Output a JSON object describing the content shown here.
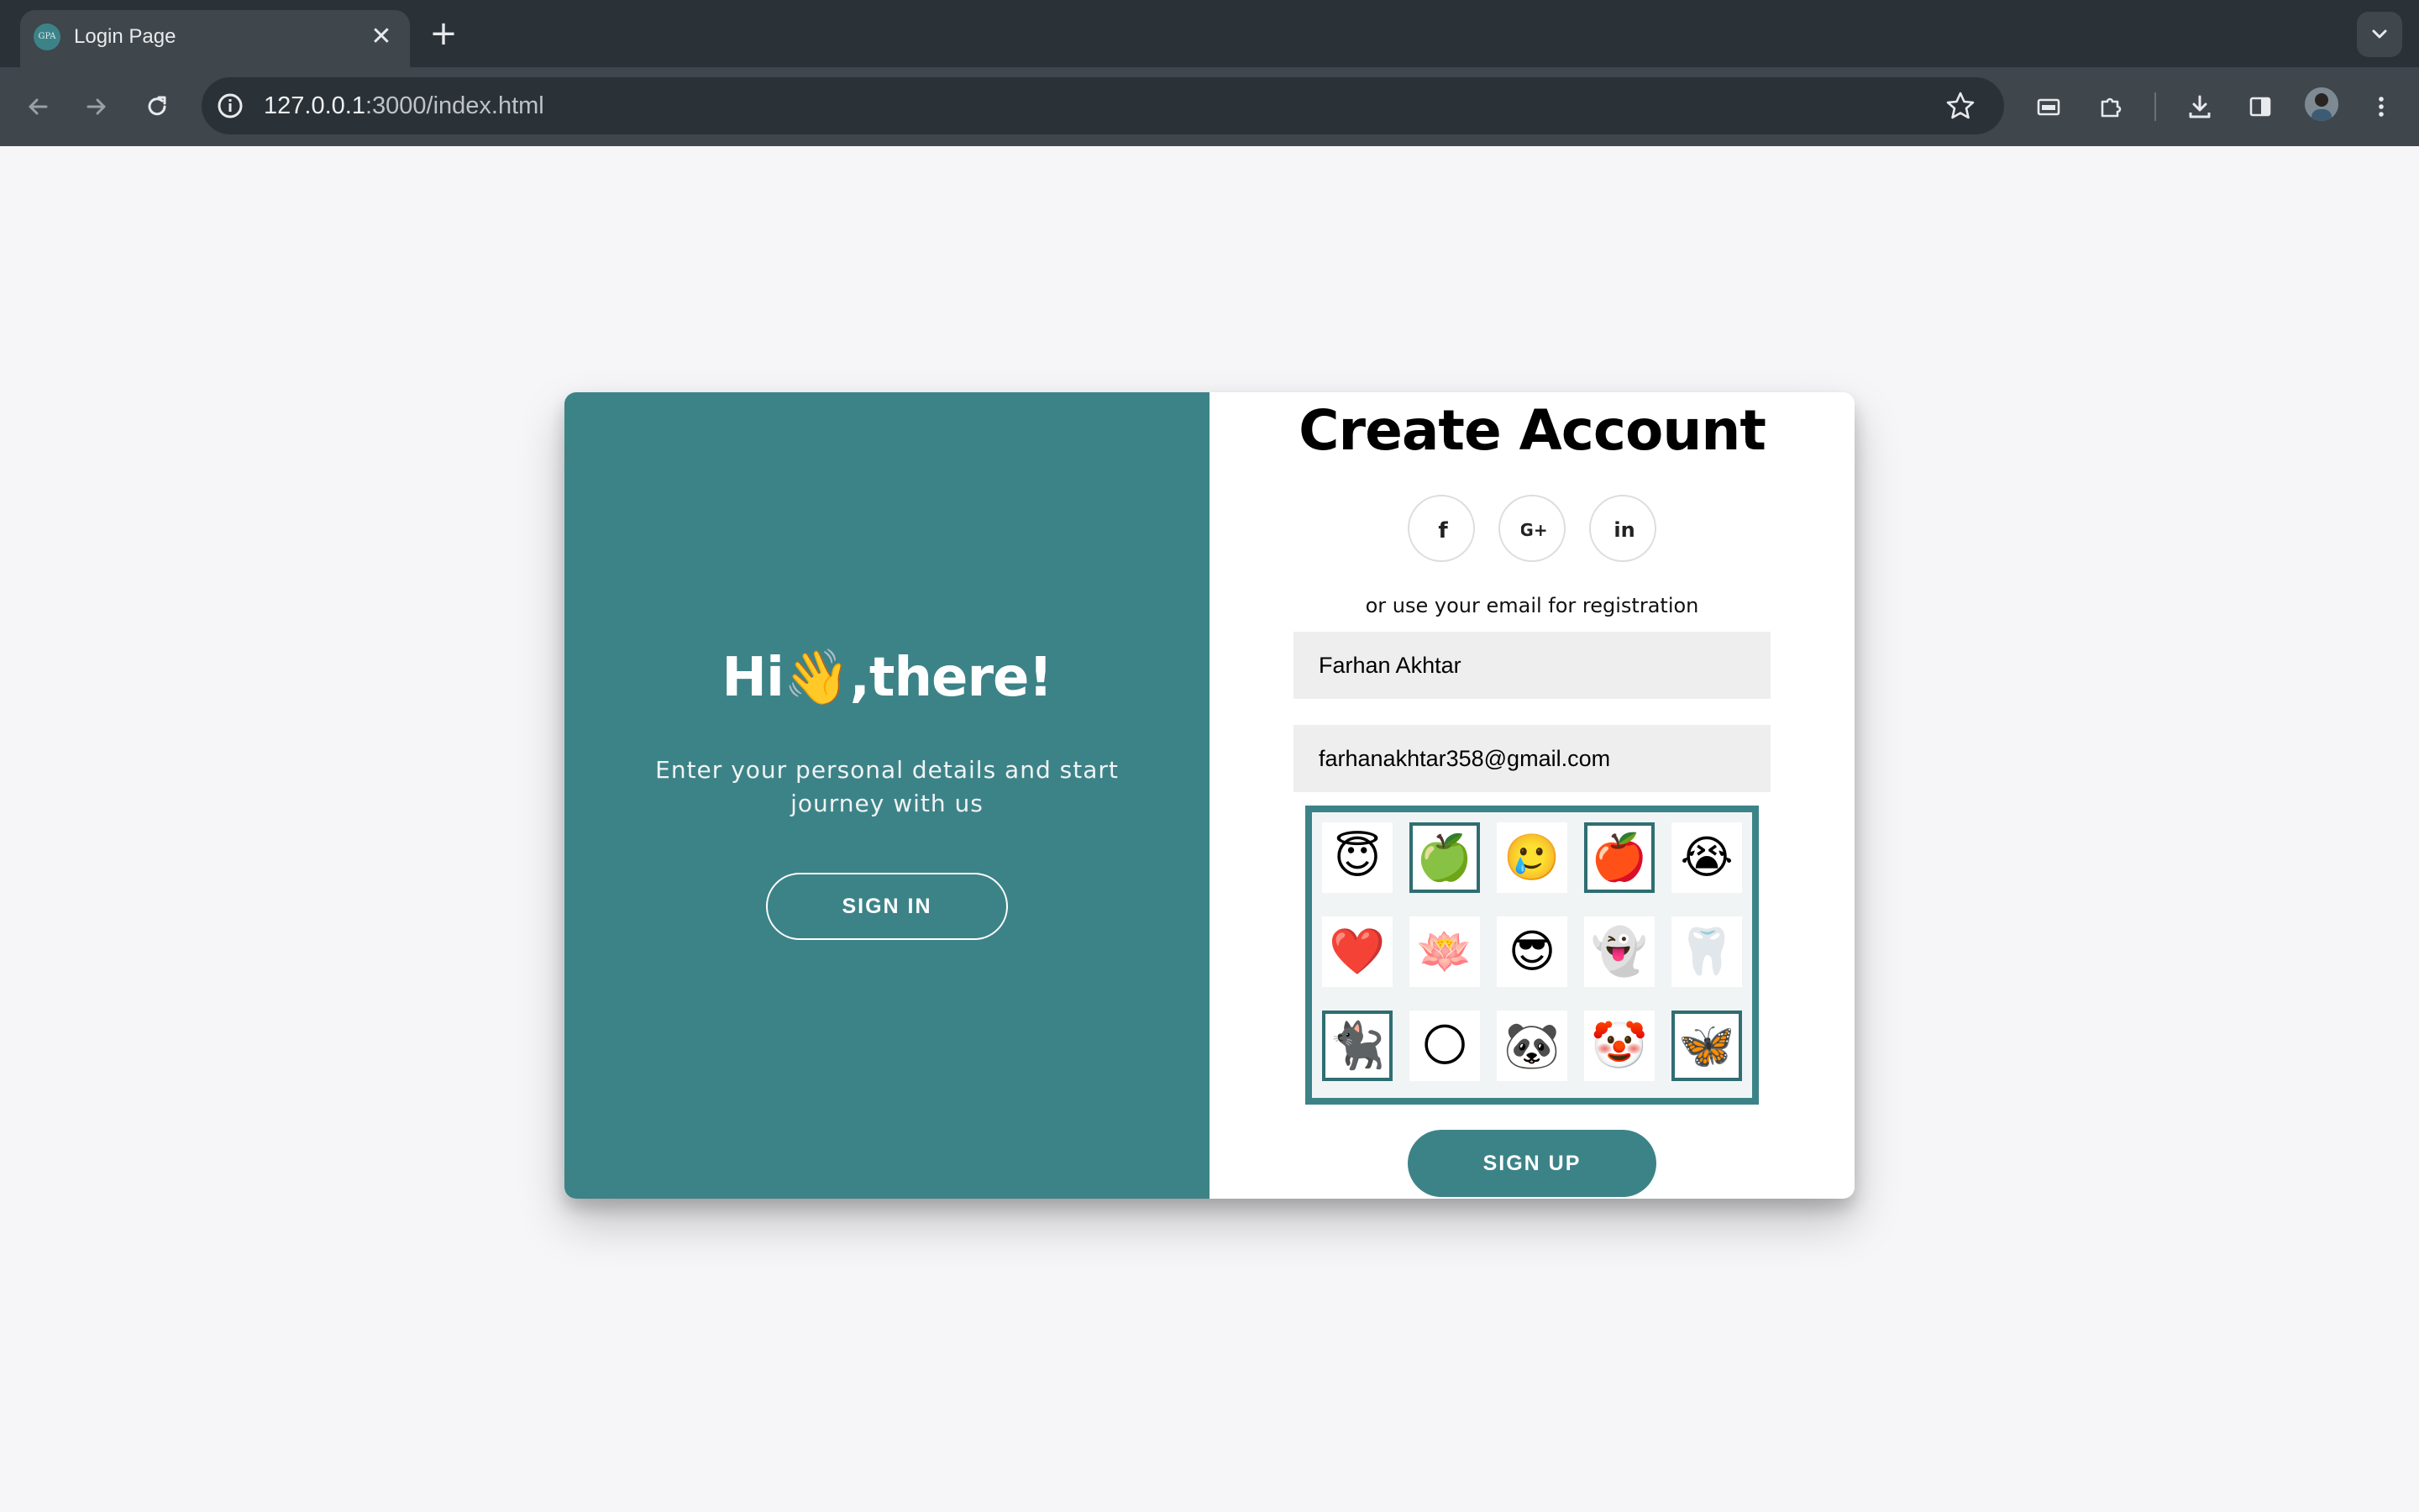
{
  "browser": {
    "tab_title": "Login Page",
    "tab_favicon_text": "GPA",
    "close_glyph": "✕",
    "new_tab_glyph": "+",
    "url_host": "127.0.0.1",
    "url_rest": ":3000/index.html",
    "icons": [
      "back-icon",
      "forward-icon",
      "reload-icon",
      "info-icon",
      "star-icon",
      "cast-icon",
      "extensions-icon",
      "download-icon",
      "sidepanel-icon",
      "avatar",
      "more-icon",
      "tab-search-icon"
    ]
  },
  "left_panel": {
    "greeting_pre": "Hi",
    "greeting_wave": "👋",
    "greeting_post": ",there!",
    "subtitle": "Enter your personal details and start journey with us",
    "sign_in_label": "SIGN IN",
    "background_color": "#3c8388"
  },
  "right_panel": {
    "title": "Create Account",
    "social": [
      "facebook-icon",
      "google-plus-icon",
      "linkedin-icon"
    ],
    "social_glyphs": [
      "f",
      "G+",
      "in"
    ],
    "or_text": "or use your email for registration",
    "name_value": "Farhan Akhtar",
    "email_value": "farhanakhtar358@gmail.com",
    "sign_up_label": "SIGN UP"
  },
  "emoji_grid": {
    "rows": [
      [
        {
          "e": "😇",
          "sel": false
        },
        {
          "e": "🍏",
          "sel": true
        },
        {
          "e": "🥲",
          "sel": false
        },
        {
          "e": "🍎",
          "sel": true
        },
        {
          "e": "😭",
          "sel": false
        }
      ],
      [
        {
          "e": "❤️",
          "sel": false
        },
        {
          "e": "🪷",
          "sel": false
        },
        {
          "e": "😎",
          "sel": false
        },
        {
          "e": "👻",
          "sel": false
        },
        {
          "e": "🦷",
          "sel": false
        }
      ],
      [
        {
          "e": "🐈‍⬛",
          "sel": true
        },
        {
          "e": "🌕",
          "sel": false
        },
        {
          "e": "🐼",
          "sel": false
        },
        {
          "e": "🤡",
          "sel": false
        },
        {
          "e": "🦋",
          "sel": true
        }
      ]
    ],
    "accent_color": "#3c8388"
  }
}
